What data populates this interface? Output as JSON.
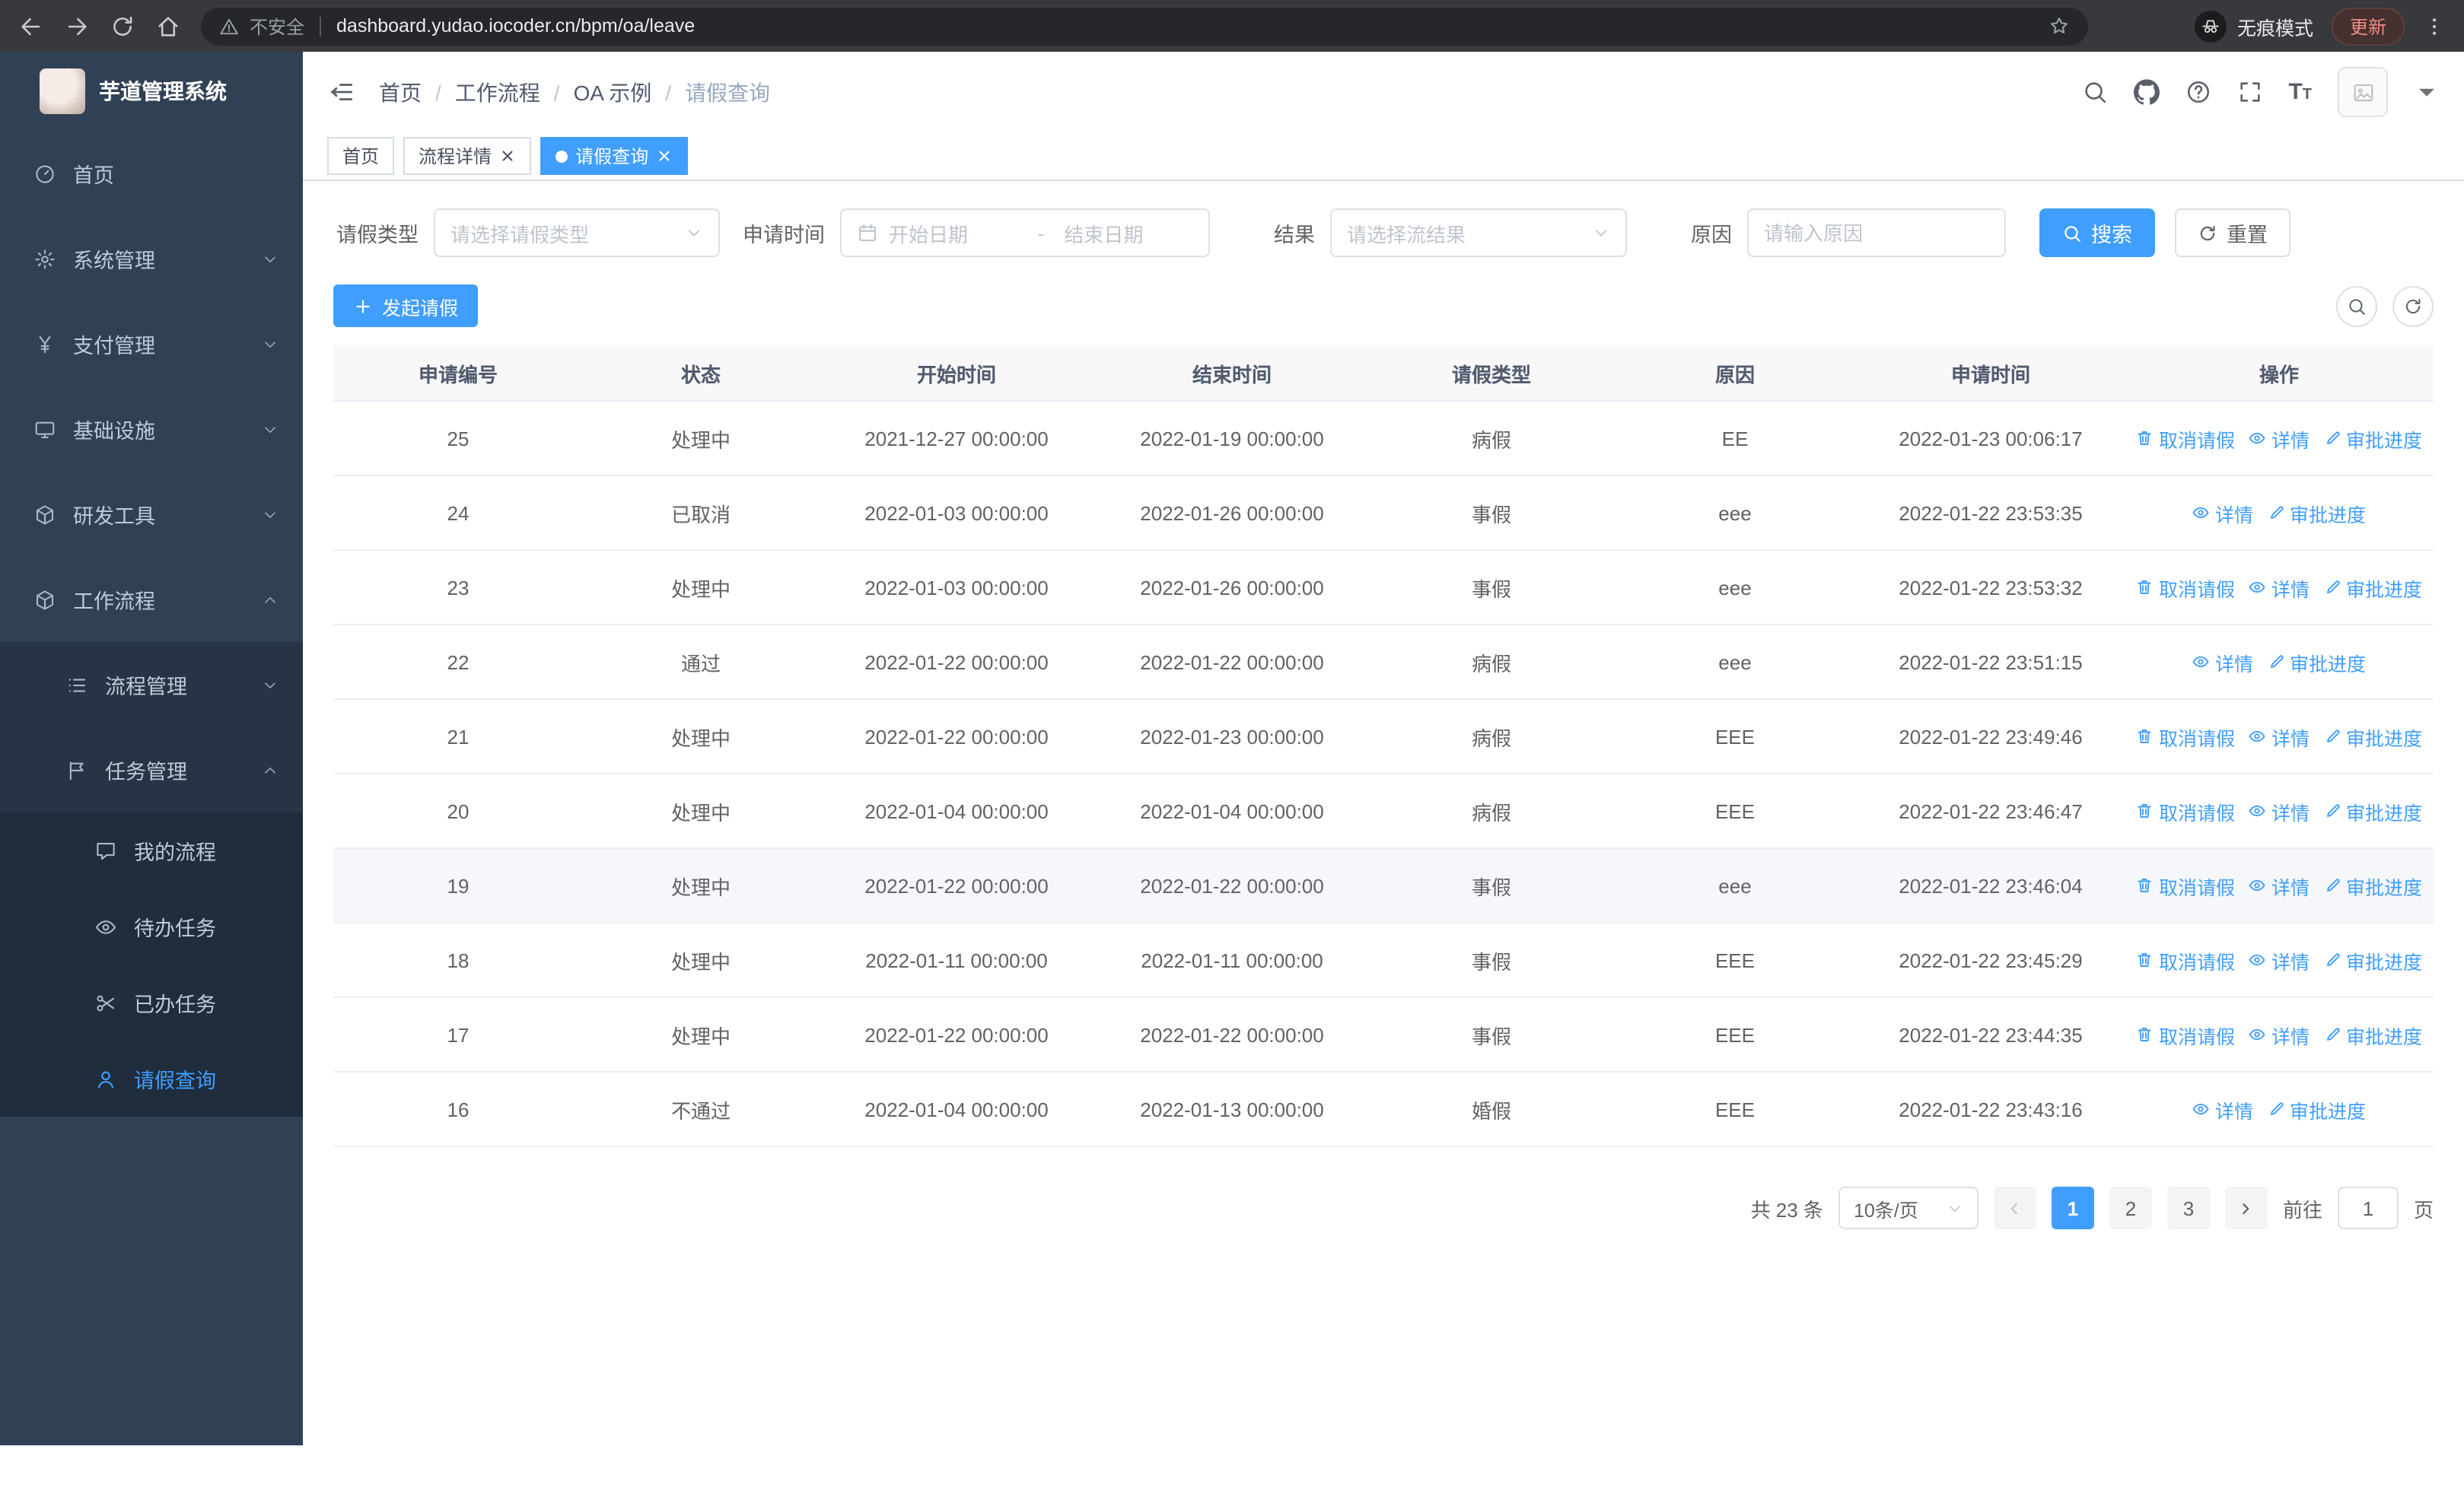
{
  "colors": {
    "primary": "#409eff",
    "sidebar_bg": "#304156",
    "submenu_bg": "#1f2d3d",
    "chrome_bg": "#38393c",
    "tab_active_bg": "#409eff"
  },
  "browser": {
    "security_label": "不安全",
    "url": "dashboard.yudao.iocoder.cn/bpm/oa/leave",
    "incognito_label": "无痕模式",
    "update_label": "更新"
  },
  "sidebar": {
    "logo_title": "芋道管理系统",
    "items": [
      {
        "label": "首页",
        "icon": "dashboard-icon",
        "expandable": false
      },
      {
        "label": "系统管理",
        "icon": "gear-icon",
        "expandable": true
      },
      {
        "label": "支付管理",
        "icon": "yen-icon",
        "expandable": true
      },
      {
        "label": "基础设施",
        "icon": "monitor-icon",
        "expandable": true
      },
      {
        "label": "研发工具",
        "icon": "box-icon",
        "expandable": true
      },
      {
        "label": "工作流程",
        "icon": "workflow-icon",
        "expandable": true,
        "expanded": true
      }
    ],
    "submenu": [
      {
        "label": "流程管理",
        "icon": "list-icon",
        "expanded": false
      },
      {
        "label": "任务管理",
        "icon": "flag-icon",
        "expanded": true
      }
    ],
    "task_items": [
      {
        "label": "我的流程",
        "icon": "chat-icon",
        "active": false
      },
      {
        "label": "待办任务",
        "icon": "eye-icon",
        "active": false
      },
      {
        "label": "已办任务",
        "icon": "done-icon",
        "active": false
      },
      {
        "label": "请假查询",
        "icon": "user-icon",
        "active": true
      }
    ]
  },
  "header": {
    "breadcrumb": [
      "首页",
      "工作流程",
      "OA 示例",
      "请假查询"
    ],
    "icons": [
      "search-icon",
      "github-icon",
      "help-icon",
      "fullscreen-icon",
      "font-size-icon"
    ]
  },
  "tabs": [
    {
      "label": "首页",
      "closable": false,
      "active": false
    },
    {
      "label": "流程详情",
      "closable": true,
      "active": false
    },
    {
      "label": "请假查询",
      "closable": true,
      "active": true
    }
  ],
  "filters": {
    "leave_type_label": "请假类型",
    "leave_type_placeholder": "请选择请假类型",
    "apply_time_label": "申请时间",
    "start_date_placeholder": "开始日期",
    "range_separator": "-",
    "end_date_placeholder": "结束日期",
    "result_label": "结果",
    "result_placeholder": "请选择流结果",
    "reason_label": "原因",
    "reason_placeholder": "请输入原因",
    "search_button": "搜索",
    "reset_button": "重置"
  },
  "toolbar": {
    "create_button": "发起请假"
  },
  "table": {
    "columns": [
      "申请编号",
      "状态",
      "开始时间",
      "结束时间",
      "请假类型",
      "原因",
      "申请时间",
      "操作"
    ],
    "actions": {
      "cancel": "取消请假",
      "detail": "详情",
      "progress": "审批进度"
    },
    "rows": [
      {
        "id": "25",
        "status": "处理中",
        "start": "2021-12-27 00:00:00",
        "end": "2022-01-19 00:00:00",
        "type": "病假",
        "reason": "EE",
        "apply_time": "2022-01-23 00:06:17",
        "can_cancel": true,
        "hover": false
      },
      {
        "id": "24",
        "status": "已取消",
        "start": "2022-01-03 00:00:00",
        "end": "2022-01-26 00:00:00",
        "type": "事假",
        "reason": "eee",
        "apply_time": "2022-01-22 23:53:35",
        "can_cancel": false,
        "hover": false
      },
      {
        "id": "23",
        "status": "处理中",
        "start": "2022-01-03 00:00:00",
        "end": "2022-01-26 00:00:00",
        "type": "事假",
        "reason": "eee",
        "apply_time": "2022-01-22 23:53:32",
        "can_cancel": true,
        "hover": false
      },
      {
        "id": "22",
        "status": "通过",
        "start": "2022-01-22 00:00:00",
        "end": "2022-01-22 00:00:00",
        "type": "病假",
        "reason": "eee",
        "apply_time": "2022-01-22 23:51:15",
        "can_cancel": false,
        "hover": false
      },
      {
        "id": "21",
        "status": "处理中",
        "start": "2022-01-22 00:00:00",
        "end": "2022-01-23 00:00:00",
        "type": "病假",
        "reason": "EEE",
        "apply_time": "2022-01-22 23:49:46",
        "can_cancel": true,
        "hover": false
      },
      {
        "id": "20",
        "status": "处理中",
        "start": "2022-01-04 00:00:00",
        "end": "2022-01-04 00:00:00",
        "type": "病假",
        "reason": "EEE",
        "apply_time": "2022-01-22 23:46:47",
        "can_cancel": true,
        "hover": false
      },
      {
        "id": "19",
        "status": "处理中",
        "start": "2022-01-22 00:00:00",
        "end": "2022-01-22 00:00:00",
        "type": "事假",
        "reason": "eee",
        "apply_time": "2022-01-22 23:46:04",
        "can_cancel": true,
        "hover": true
      },
      {
        "id": "18",
        "status": "处理中",
        "start": "2022-01-11 00:00:00",
        "end": "2022-01-11 00:00:00",
        "type": "事假",
        "reason": "EEE",
        "apply_time": "2022-01-22 23:45:29",
        "can_cancel": true,
        "hover": false
      },
      {
        "id": "17",
        "status": "处理中",
        "start": "2022-01-22 00:00:00",
        "end": "2022-01-22 00:00:00",
        "type": "事假",
        "reason": "EEE",
        "apply_time": "2022-01-22 23:44:35",
        "can_cancel": true,
        "hover": false
      },
      {
        "id": "16",
        "status": "不通过",
        "start": "2022-01-04 00:00:00",
        "end": "2022-01-13 00:00:00",
        "type": "婚假",
        "reason": "EEE",
        "apply_time": "2022-01-22 23:43:16",
        "can_cancel": false,
        "hover": false
      }
    ]
  },
  "pagination": {
    "total_text": "共 23 条",
    "page_size": "10条/页",
    "pages": [
      "1",
      "2",
      "3"
    ],
    "current_page": "1",
    "goto_label": "前往",
    "goto_value": "1",
    "page_label": "页"
  }
}
